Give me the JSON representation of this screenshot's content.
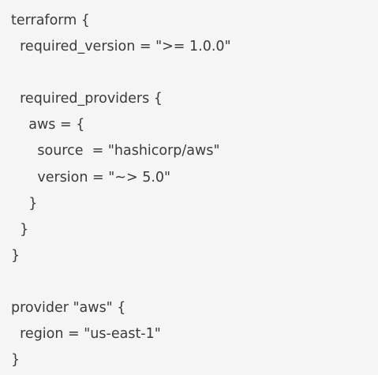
{
  "code": {
    "language": "hcl",
    "lines": [
      "terraform {",
      "  required_version = \">= 1.0.0\"",
      "",
      "  required_providers {",
      "    aws = {",
      "      source  = \"hashicorp/aws\"",
      "      version = \"~> 5.0\"",
      "    }",
      "  }",
      "}",
      "",
      "provider \"aws\" {",
      "  region = \"us-east-1\"",
      "}"
    ]
  }
}
